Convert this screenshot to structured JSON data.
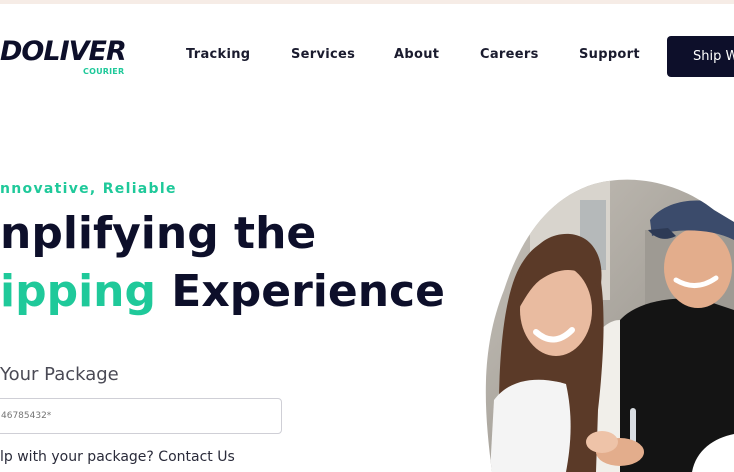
{
  "brand": {
    "name": "DOLIVER",
    "tagline": "COURIER"
  },
  "nav": {
    "items": [
      "Tracking",
      "Services",
      "About",
      "Careers",
      "Support"
    ],
    "cta_label": "Ship W"
  },
  "hero": {
    "eyebrow": "nnovative, Reliable",
    "headline_line1": "nplifying the",
    "headline_accent": "ipping",
    "headline_line2_rest": " Experience"
  },
  "tracking": {
    "label": "Your Package",
    "input_placeholder": "46785432*",
    "help_prefix": "lp with your package? ",
    "help_link": "Contact Us"
  },
  "colors": {
    "accent": "#1fc99a",
    "navy": "#0d0f2a"
  }
}
